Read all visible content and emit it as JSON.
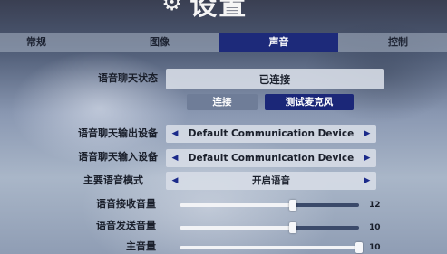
{
  "title": "设置",
  "tabs": [
    {
      "label": "常规",
      "active": false
    },
    {
      "label": "图像",
      "active": false
    },
    {
      "label": "声音",
      "active": true
    },
    {
      "label": "控制",
      "active": false
    }
  ],
  "voice_chat_status": {
    "label": "语音聊天状态",
    "value": "已连接"
  },
  "buttons": {
    "connect": "连接",
    "test_mic": "测试麦克风"
  },
  "output_device": {
    "label": "语音聊天输出设备",
    "value": "Default Communication Device"
  },
  "input_device": {
    "label": "语音聊天输入设备",
    "value": "Default Communication Device"
  },
  "voice_mode": {
    "label": "主要语音模式",
    "value": "开启语音"
  },
  "sliders": {
    "receive": {
      "label": "语音接收音量",
      "value": "12",
      "fraction": 0.63
    },
    "send": {
      "label": "语音发送音量",
      "value": "10",
      "fraction": 0.63
    },
    "master": {
      "label": "主音量",
      "value": "10",
      "fraction": 1.0
    }
  },
  "icons": {
    "title": "gear-icon",
    "prev": "arrow-left-icon",
    "next": "arrow-right-icon"
  },
  "colors": {
    "accent": "#1d2a7a",
    "arrow": "#1b2a8a"
  }
}
